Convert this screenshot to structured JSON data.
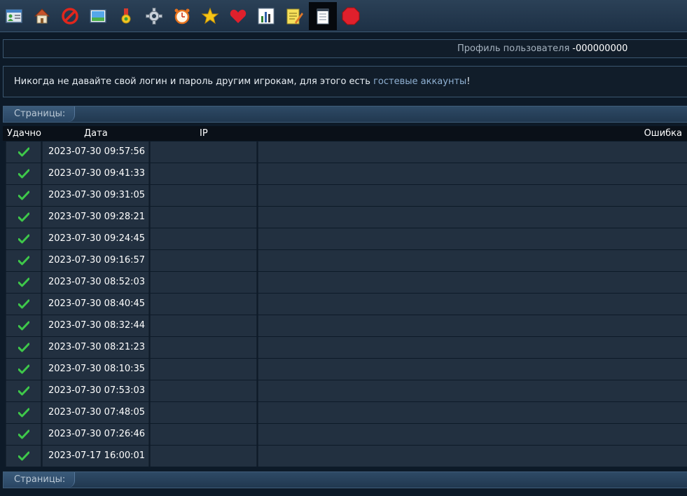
{
  "toolbar": {
    "icons": [
      {
        "name": "contacts-icon"
      },
      {
        "name": "home-icon"
      },
      {
        "name": "forbidden-icon"
      },
      {
        "name": "picture-icon"
      },
      {
        "name": "medal-icon"
      },
      {
        "name": "gear-icon"
      },
      {
        "name": "alarm-clock-icon"
      },
      {
        "name": "star-icon"
      },
      {
        "name": "heart-icon"
      },
      {
        "name": "bar-chart-icon"
      },
      {
        "name": "notepad-pencil-icon"
      },
      {
        "name": "notepad-icon",
        "active": true
      },
      {
        "name": "stop-icon"
      }
    ]
  },
  "profile": {
    "label": "Профиль пользователя",
    "user_id": "-000000000"
  },
  "notice": {
    "text_before": "Никогда не давайте свой логин и пароль другим игрокам, для этого есть ",
    "link_text": "гостевые аккаунты",
    "text_after": "!"
  },
  "pages": {
    "label": "Страницы:"
  },
  "table": {
    "headers": {
      "success": "Удачно",
      "date": "Дата",
      "ip": "IP",
      "error": "Ошибка"
    },
    "rows": [
      {
        "success": true,
        "date": "2023-07-30 09:57:56",
        "ip": "",
        "error": ""
      },
      {
        "success": true,
        "date": "2023-07-30 09:41:33",
        "ip": "",
        "error": ""
      },
      {
        "success": true,
        "date": "2023-07-30 09:31:05",
        "ip": "",
        "error": ""
      },
      {
        "success": true,
        "date": "2023-07-30 09:28:21",
        "ip": "",
        "error": ""
      },
      {
        "success": true,
        "date": "2023-07-30 09:24:45",
        "ip": "",
        "error": ""
      },
      {
        "success": true,
        "date": "2023-07-30 09:16:57",
        "ip": "",
        "error": ""
      },
      {
        "success": true,
        "date": "2023-07-30 08:52:03",
        "ip": "",
        "error": ""
      },
      {
        "success": true,
        "date": "2023-07-30 08:40:45",
        "ip": "",
        "error": ""
      },
      {
        "success": true,
        "date": "2023-07-30 08:32:44",
        "ip": "",
        "error": ""
      },
      {
        "success": true,
        "date": "2023-07-30 08:21:23",
        "ip": "",
        "error": ""
      },
      {
        "success": true,
        "date": "2023-07-30 08:10:35",
        "ip": "",
        "error": ""
      },
      {
        "success": true,
        "date": "2023-07-30 07:53:03",
        "ip": "",
        "error": ""
      },
      {
        "success": true,
        "date": "2023-07-30 07:48:05",
        "ip": "",
        "error": ""
      },
      {
        "success": true,
        "date": "2023-07-30 07:26:46",
        "ip": "",
        "error": ""
      },
      {
        "success": true,
        "date": "2023-07-17 16:00:01",
        "ip": "",
        "error": ""
      }
    ]
  },
  "colors": {
    "background": "#0d1a28",
    "accent_link": "#8fb0d2",
    "success_green": "#3ec84a"
  }
}
